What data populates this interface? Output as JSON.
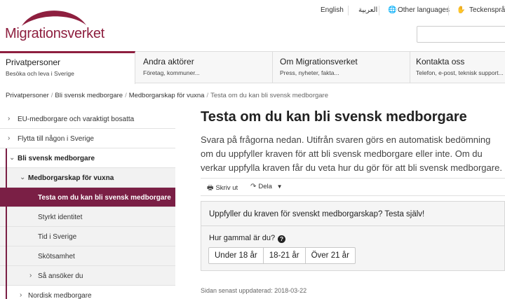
{
  "header": {
    "logo_text": "Migrationsverket",
    "brand_color": "#8e1f3f",
    "toplinks": {
      "english": "English",
      "arabic": "العربية",
      "other_languages": "Other languages",
      "sign_language": "Teckenspråk"
    },
    "search": {
      "placeholder": ""
    }
  },
  "mainnav": [
    {
      "title": "Privatpersoner",
      "sub": "Besöka och leva i Sverige"
    },
    {
      "title": "Andra aktörer",
      "sub": "Företag, kommuner..."
    },
    {
      "title": "Om Migrationsverket",
      "sub": "Press, nyheter, fakta..."
    },
    {
      "title": "Kontakta oss",
      "sub": "Telefon, e-post, teknisk support..."
    }
  ],
  "breadcrumb": [
    "Privatpersoner",
    "Bli svensk medborgare",
    "Medborgarskap för vuxna",
    "Testa om du kan bli svensk medborgare"
  ],
  "sidebar": {
    "items": [
      {
        "label": "EU-medborgare och varaktigt bosatta"
      },
      {
        "label": "Flytta till någon i Sverige"
      },
      {
        "label": "Bli svensk medborgare"
      },
      {
        "label": "Medborgarskap för vuxna"
      },
      {
        "label": "Testa om du kan bli svensk medborgare"
      },
      {
        "label": "Styrkt identitet"
      },
      {
        "label": "Tid i Sverige"
      },
      {
        "label": "Skötsamhet"
      },
      {
        "label": "Så ansöker du"
      },
      {
        "label": "Nordisk medborgare"
      }
    ],
    "active_color": "#7a1f45"
  },
  "main": {
    "title": "Testa om du kan bli svensk medborgare",
    "intro": "Svara på frågorna nedan. Utifrån svaren görs en automatisk bedömning om du uppfyller kraven för att bli svensk medborgare eller inte. Om du verkar uppfylla kraven får du veta hur du gör för att bli svensk medborgare.",
    "tools": {
      "print": "Skriv ut",
      "share": "Dela"
    },
    "quiz": {
      "title": "Uppfyller du kraven för svenskt medborgarskap? Testa själv!",
      "question": "Hur gammal är du?",
      "help": "?",
      "options": [
        "Under 18 år",
        "18-21 år",
        "Över 21 år"
      ]
    },
    "updated": "Sidan senast uppdaterad: 2018-03-22"
  }
}
